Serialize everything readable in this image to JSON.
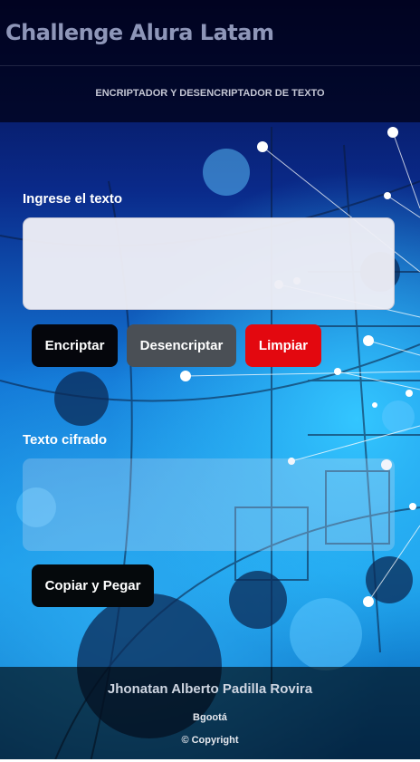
{
  "header": {
    "brand": "Challenge Alura Latam",
    "subtitle": "ENCRIPTADOR Y DESENCRIPTADOR DE TEXTO"
  },
  "input_section": {
    "label": "Ingrese el texto",
    "value": "",
    "placeholder": ""
  },
  "actions": {
    "encrypt_label": "Encriptar",
    "decrypt_label": "Desencriptar",
    "clear_label": "Limpiar"
  },
  "output_section": {
    "label": "Texto cifrado",
    "value": "",
    "placeholder": "",
    "copy_label": "Copiar y Pegar"
  },
  "footer": {
    "author": "Jhonatan Alberto Padilla Rovira",
    "city": "Bgootá",
    "copyright": "© Copyright"
  },
  "colors": {
    "encrypt_button": "#05060c",
    "decrypt_button": "#4a4f55",
    "clear_button": "#e3080f",
    "copy_button": "#05090c",
    "overlay": "#000014"
  }
}
